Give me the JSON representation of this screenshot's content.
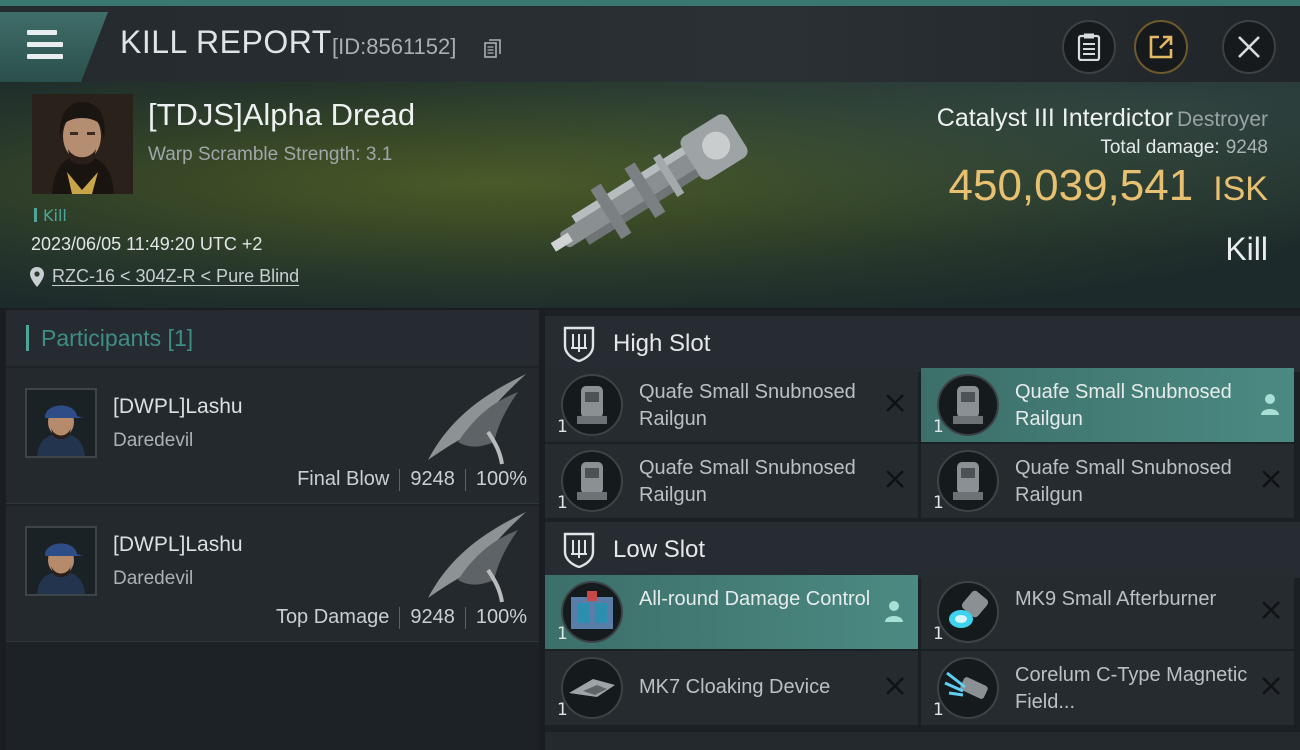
{
  "header": {
    "title": "KILL REPORT",
    "report_id": "[ID:8561152]"
  },
  "victim": {
    "pilot_name": "[TDJS]Alpha Dread",
    "warp_scramble": "Warp Scramble Strength: 3.1",
    "tag": "Kill",
    "datetime": "2023/06/05 11:49:20 UTC +2",
    "location": "RZC-16 < 304Z-R < Pure Blind",
    "ship_name": "Catalyst III Interdictor",
    "ship_class": "Destroyer",
    "total_damage_label": "Total damage:",
    "total_damage": "9248",
    "isk_value": "450,039,541",
    "isk_unit": "ISK",
    "result": "Kill"
  },
  "participants": {
    "title": "Participants [1]",
    "list": [
      {
        "name": "[DWPL]Lashu",
        "ship": "Daredevil",
        "role": "Final Blow",
        "damage": "9248",
        "percent": "100%"
      },
      {
        "name": "[DWPL]Lashu",
        "ship": "Daredevil",
        "role": "Top Damage",
        "damage": "9248",
        "percent": "100%"
      }
    ]
  },
  "fitting": {
    "high_slot": {
      "label": "High Slot",
      "modules": [
        {
          "name": "Quafe Small Snubnosed Railgun",
          "qty": "1",
          "active": false
        },
        {
          "name": "Quafe Small Snubnosed Railgun",
          "qty": "1",
          "active": true
        },
        {
          "name": "Quafe Small Snubnosed Railgun",
          "qty": "1",
          "active": false
        },
        {
          "name": "Quafe Small Snubnosed Railgun",
          "qty": "1",
          "active": false
        }
      ]
    },
    "low_slot": {
      "label": "Low Slot",
      "modules": [
        {
          "name": "All-round Damage Control",
          "qty": "1",
          "active": true
        },
        {
          "name": "MK9 Small Afterburner",
          "qty": "1",
          "active": false
        },
        {
          "name": "MK7 Cloaking Device",
          "qty": "1",
          "active": false
        },
        {
          "name": "Corelum C-Type Magnetic Field...",
          "qty": "1",
          "active": false
        }
      ]
    }
  },
  "icons": {
    "menu": "menu-icon",
    "copy": "copy-icon",
    "clipboard": "clipboard-icon",
    "share": "share-icon",
    "close": "close-icon",
    "location": "location-pin-icon",
    "slot": "shield-icon",
    "remove": "close-x-icon",
    "person": "person-icon"
  },
  "colors": {
    "accent_teal": "#4ea69a",
    "isk_gold": "#e8c071",
    "active_module": "#4b8a82"
  }
}
